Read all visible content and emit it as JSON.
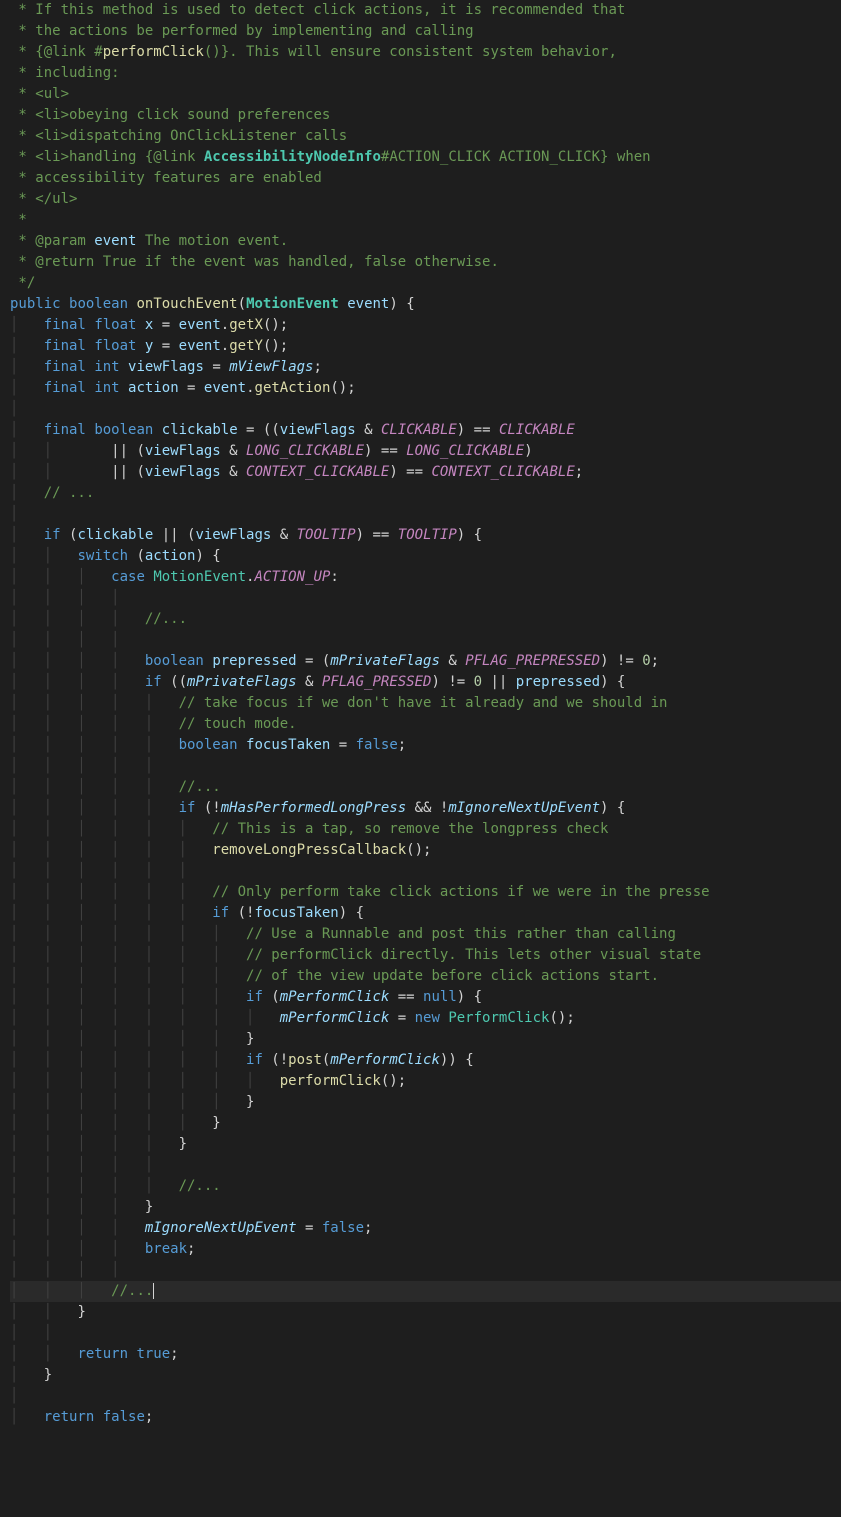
{
  "doc": {
    "l1": " * If this method is used to detect click actions, it is recommended that",
    "l2": " * the actions be performed by implementing and calling",
    "l3a": " * {@link #",
    "l3b": "performClick",
    "l3c": "()}. This will ensure consistent system behavior,",
    "l4": " * including:",
    "l5": " * <ul>",
    "l6a": " * <li>",
    "l6b": "obeying click sound preferences",
    "l7a": " * <li>",
    "l7b": "dispatching OnClickListener calls",
    "l8a": " * <li>",
    "l8b": "handling {@link ",
    "l8c": "AccessibilityNodeInfo",
    "l8d": "#ACTION_CLICK ACTION_CLICK} when",
    "l9": " * accessibility features are enabled",
    "l10": " * </ul>",
    "l11": " *",
    "l12a": " * @param ",
    "l12b": "event",
    "l12c": " The motion event.",
    "l13a": " * @return ",
    "l13b": "True if the event was handled, false otherwise.",
    "l14": " */"
  },
  "kw": {
    "public": "public",
    "boolean": "boolean",
    "final": "final",
    "float": "float",
    "int": "int",
    "if": "if",
    "switch": "switch",
    "case": "case",
    "break": "break",
    "return": "return",
    "true": "true",
    "false": "false",
    "new": "new",
    "null": "null"
  },
  "id": {
    "onTouchEvent": "onTouchEvent",
    "MotionEvent": "MotionEvent",
    "event": "event",
    "x": "x",
    "y": "y",
    "getX": "getX",
    "getY": "getY",
    "viewFlags": "viewFlags",
    "mViewFlags": "mViewFlags",
    "action": "action",
    "getAction": "getAction",
    "clickable": "clickable",
    "CLICKABLE": "CLICKABLE",
    "LONG_CLICKABLE": "LONG_CLICKABLE",
    "CONTEXT_CLICKABLE": "CONTEXT_CLICKABLE",
    "TOOLTIP": "TOOLTIP",
    "ACTION_UP": "ACTION_UP",
    "prepressed": "prepressed",
    "mPrivateFlags": "mPrivateFlags",
    "PFLAG_PREPRESSED": "PFLAG_PREPRESSED",
    "PFLAG_PRESSED": "PFLAG_PRESSED",
    "focusTaken": "focusTaken",
    "mHasPerformedLongPress": "mHasPerformedLongPress",
    "mIgnoreNextUpEvent": "mIgnoreNextUpEvent",
    "removeLongPressCallback": "removeLongPressCallback",
    "mPerformClick": "mPerformClick",
    "PerformClick": "PerformClick",
    "post": "post",
    "performClick": "performClick",
    "zero": "0"
  },
  "cm": {
    "dots": "// ...",
    "dotsc": "//...",
    "take1": "// take focus if we don't have it already and we should in",
    "take2": "// touch mode.",
    "tap": "// This is a tap, so remove the longpress check",
    "only": "// Only perform take click actions if we were in the presse",
    "r1": "// Use a Runnable and post this rather than calling",
    "r2": "// performClick directly. This lets other visual state",
    "r3": "// of the view update before click actions start."
  }
}
